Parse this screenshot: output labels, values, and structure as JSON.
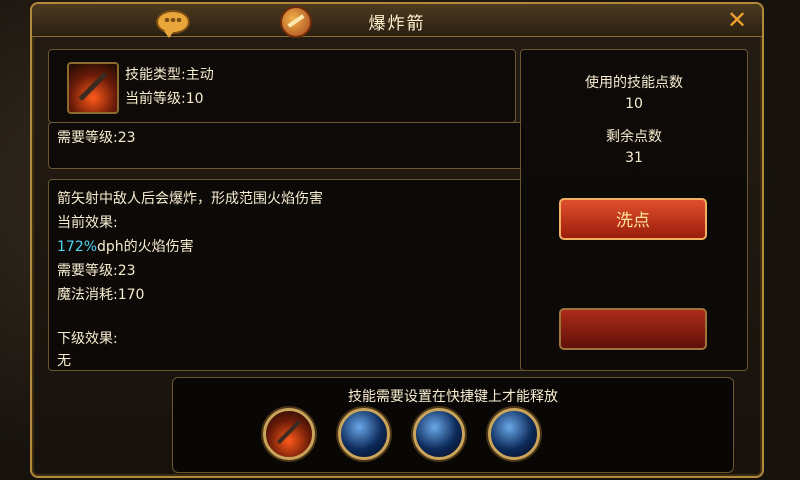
{
  "window": {
    "title": "爆炸箭"
  },
  "header": {
    "type_line": "技能类型:主动",
    "level_line": "当前等级:10"
  },
  "requirement": {
    "text": "需要等级:23"
  },
  "description": {
    "line1": "箭矢射中敌人后会爆炸，形成范围火焰伤害",
    "current_label": "当前效果:",
    "damage_value": "172%",
    "damage_text": "dph的火焰伤害",
    "req_level": "需要等级:23",
    "mana_cost": "魔法消耗:170",
    "next_label": "下级效果:",
    "next_partial": "无"
  },
  "side": {
    "used_label": "使用的技能点数",
    "used_value": "10",
    "remaining_label": "剩余点数",
    "remaining_value": "31",
    "reset_button": "洗点"
  },
  "slots": {
    "hint": "技能需要设置在快捷键上才能释放"
  },
  "colors": {
    "accent": "#b38a3a",
    "cyan": "#4fd6f3",
    "button_red": "#c0301c"
  }
}
